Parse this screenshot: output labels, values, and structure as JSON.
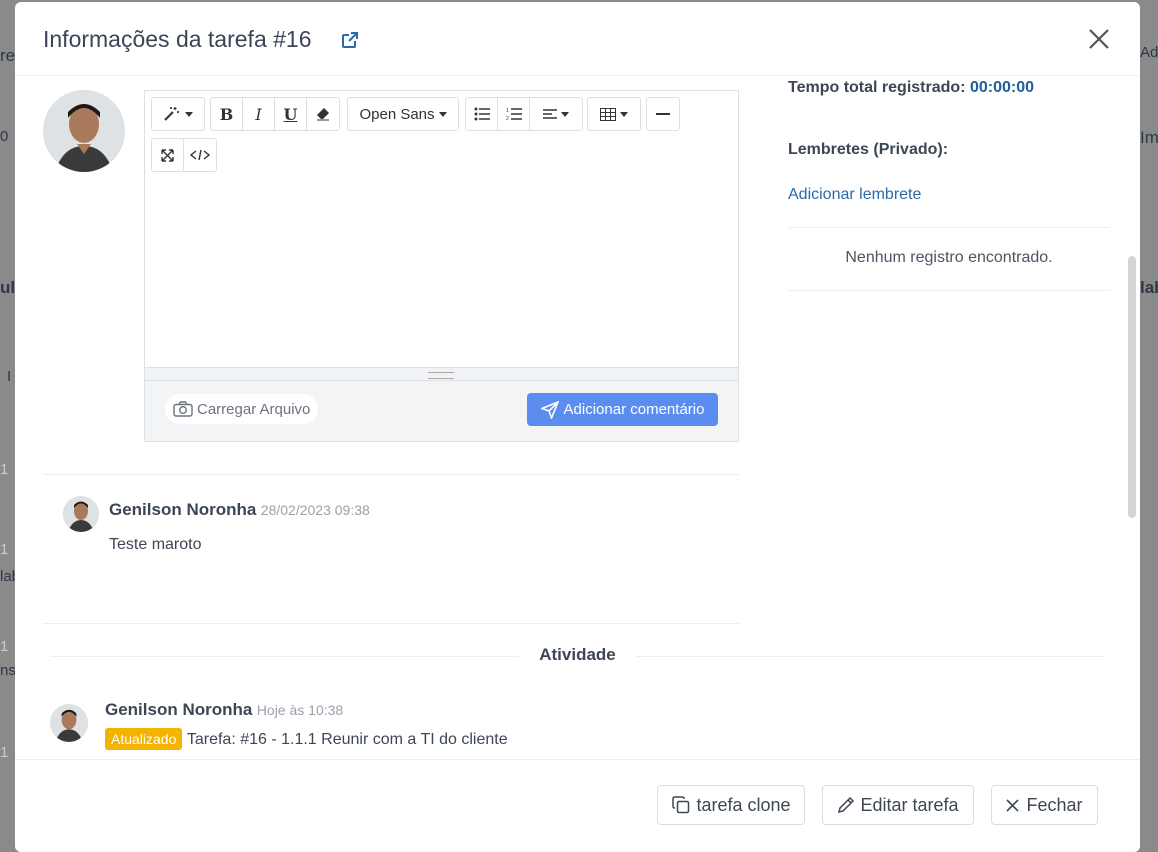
{
  "background": {
    "fragments": [
      "re",
      "0",
      "ul",
      "I",
      "1",
      "1",
      "lab",
      "1",
      "ns",
      "1",
      "Adı",
      "Im",
      "lab"
    ]
  },
  "modal": {
    "title": "Informações da tarefa #16",
    "editor": {
      "font_name": "Open Sans",
      "upload_label": "Carregar Arquivo",
      "add_comment_label": "Adicionar comentário"
    },
    "comment": {
      "author": "Genilson Noronha",
      "date": "28/02/2023 09:38",
      "text": "Teste maroto"
    },
    "sidebar": {
      "total_time_label": "Tempo total registrado:",
      "total_time_value": "00:00:00",
      "reminders_label": "Lembretes (Privado):",
      "add_reminder_link": "Adicionar lembrete",
      "empty_message": "Nenhum registro encontrado."
    },
    "activity": {
      "section_title": "Atividade",
      "entries": [
        {
          "author": "Genilson Noronha",
          "time": "Hoje às 10:38",
          "badge": "Atualizado",
          "text": "Tarefa: #16 - 1.1.1 Reunir com a TI do cliente"
        }
      ]
    },
    "footer": {
      "clone_label": "tarefa clone",
      "edit_label": "Editar tarefa",
      "close_label": "Fechar"
    }
  },
  "colors": {
    "primary": "#5b8cf0",
    "link": "#2a6aa8",
    "timer": "#1f5f9a",
    "badge": "#f5b301"
  }
}
